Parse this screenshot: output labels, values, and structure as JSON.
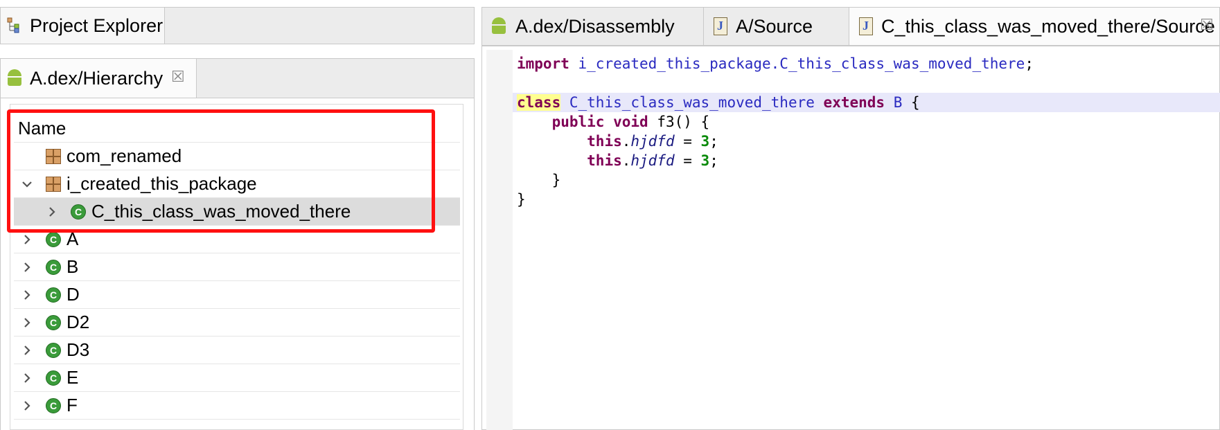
{
  "left_panel": {
    "top_tab": {
      "label": "Project Explorer"
    },
    "view_tab": {
      "label": "A.dex/Hierarchy",
      "close_glyph": "☒"
    },
    "tree": {
      "column_header": "Name",
      "rows": [
        {
          "label": "com_renamed",
          "icon": "package-icon",
          "expander": ""
        },
        {
          "label": "i_created_this_package",
          "icon": "package-icon",
          "expander": "⌵"
        },
        {
          "label": "C_this_class_was_moved_there",
          "icon": "class-icon",
          "expander": "›"
        },
        {
          "label": "A",
          "icon": "class-icon",
          "expander": "›"
        },
        {
          "label": "B",
          "icon": "class-icon",
          "expander": "›"
        },
        {
          "label": "D",
          "icon": "class-icon",
          "expander": "›"
        },
        {
          "label": "D2",
          "icon": "class-icon",
          "expander": "›"
        },
        {
          "label": "D3",
          "icon": "class-icon",
          "expander": "›"
        },
        {
          "label": "E",
          "icon": "class-icon",
          "expander": "›"
        },
        {
          "label": "F",
          "icon": "class-icon",
          "expander": "›"
        }
      ],
      "selected_row": "C_this_class_was_moved_there",
      "highlight_color": "#ff1010"
    }
  },
  "editor": {
    "tabs": [
      {
        "label": "A.dex/Disassembly",
        "icon": "android-icon"
      },
      {
        "label": "A/Source",
        "icon": "java-file-icon"
      },
      {
        "label": "C_this_class_was_moved_there/Source",
        "icon": "java-file-icon",
        "active": true,
        "close_glyph": "☒"
      }
    ],
    "code": {
      "l1_kw": "import",
      "l1_pkg": "i_created_this_package.C_this_class_was_moved_there",
      "l1_end": ";",
      "l3_kw": "class",
      "l3_name": "C_this_class_was_moved_there",
      "l3_ext": "extends",
      "l3_super": "B",
      "l3_brace": "{",
      "l4_kw1": "public",
      "l4_kw2": "void",
      "l4_rest": "f3() {",
      "l5_this": "this",
      "l5_field": "hjdfd",
      "l5_eq": " = ",
      "l5_num": "3",
      "l5_end": ";",
      "l6_this": "this",
      "l6_field": "hjdfd",
      "l6_eq": " = ",
      "l6_num": "3",
      "l6_end": ";",
      "l7": "}",
      "l8": "}"
    }
  }
}
